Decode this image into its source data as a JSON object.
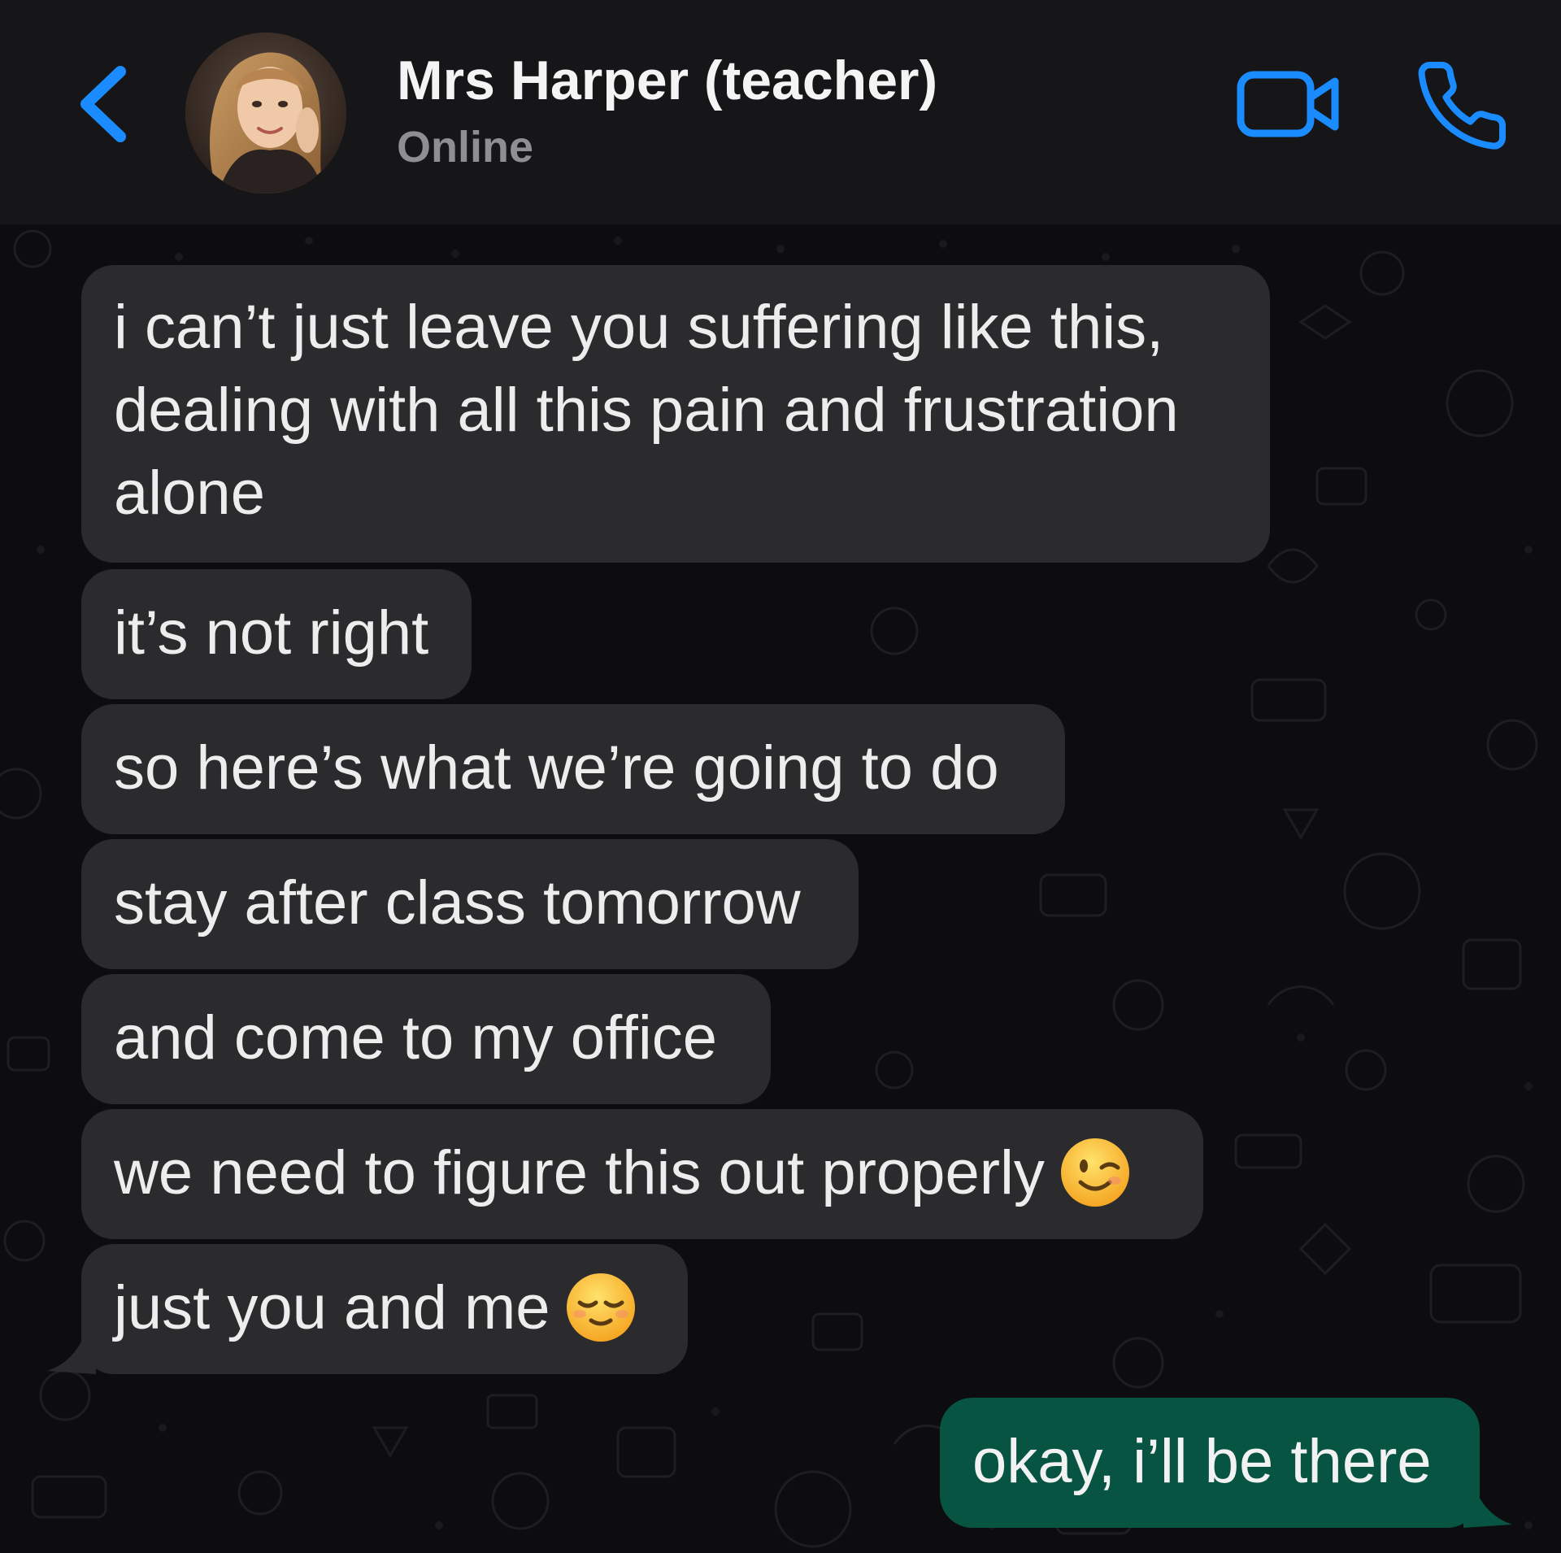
{
  "header": {
    "contact_name": "Mrs Harper (teacher)",
    "status": "Online"
  },
  "messages": [
    {
      "direction": "incoming",
      "text": "i can’t just leave you suffering like this, dealing with all this pain and frustration alone"
    },
    {
      "direction": "incoming",
      "text": "it’s not right"
    },
    {
      "direction": "incoming",
      "text": "so here’s what we’re going to do"
    },
    {
      "direction": "incoming",
      "text": "stay after class tomorrow"
    },
    {
      "direction": "incoming",
      "text": "and come to my office"
    },
    {
      "direction": "incoming",
      "text": "we need to figure this out properly",
      "emoji": "winking-face-emoji"
    },
    {
      "direction": "incoming",
      "text": "just you and me",
      "emoji": "relieved-face-emoji"
    },
    {
      "direction": "outgoing",
      "text": "okay, i’ll be there"
    }
  ],
  "colors": {
    "accent": "#1a8cff",
    "header_bg": "#161618",
    "chat_bg": "#0d0d0f",
    "incoming_bubble": "#2b2b2d",
    "outgoing_bubble": "#075443",
    "status_text": "#8e8e93"
  }
}
